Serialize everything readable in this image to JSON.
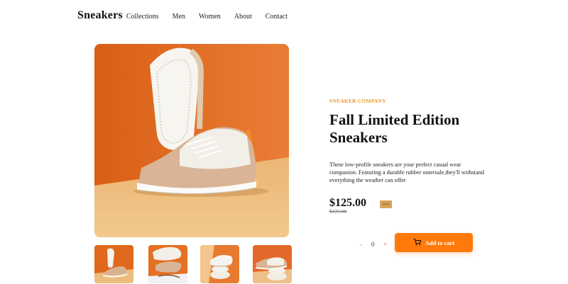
{
  "header": {
    "brand": "Sneakers",
    "nav": [
      "Collections",
      "Men",
      "Women",
      "About",
      "Contact"
    ]
  },
  "product": {
    "company": "SNEAKER COMPANY",
    "title": "Fall Limited Edition Sneakers",
    "description": "These low-profile sneakers are your perfect casual wear companion. Featuring a durable rubber outersale,they'll withstand everything the weather can offer",
    "price": "$125.00",
    "discount": "50%",
    "original_price": "$125.00"
  },
  "cart": {
    "minus": "-",
    "quantity": "0",
    "plus": "+",
    "add_label": "Add to cart"
  },
  "colors": {
    "accent": "#ff7a0a",
    "company_text": "#ee9a2a",
    "image_orange": "#e06a1e",
    "image_sand": "#e8b976"
  }
}
